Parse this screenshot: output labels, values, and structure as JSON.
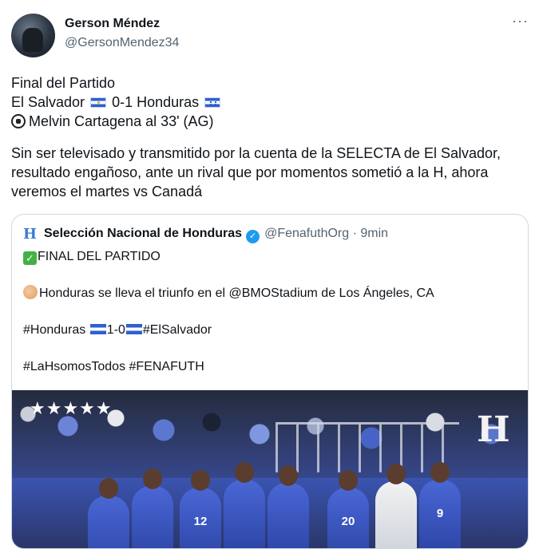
{
  "author": {
    "name": "Gerson Méndez",
    "handle": "@GersonMendez34",
    "more_label": "···"
  },
  "tweet": {
    "line1": "Final del  Partido",
    "score_team1": "El Salvador",
    "score": "0-1",
    "score_team2": "Honduras",
    "scorer": "Melvin Cartagena al 33' (AG)",
    "paragraph": "Sin ser televisado y transmitido por la cuenta de la SELECTA de El Salvador, resultado engañoso, ante un rival que por momentos sometió a la H, ahora veremos el martes vs Canadá"
  },
  "quoted": {
    "logo_letter": "H",
    "name": "Selección Nacional de Honduras",
    "verified_glyph": "✓",
    "handle": "@FenafuthOrg",
    "separator": "·",
    "time": "9min",
    "line1": "FINAL DEL PARTIDO",
    "line2": "Honduras se lleva el triunfo en el @BMOStadium de Los Ángeles, CA",
    "line3_a": "#Honduras",
    "line3_b": "1-0",
    "line3_c": "#ElSalvador",
    "line4": "#LaHsomosTodos #FENAFUTH"
  },
  "photo": {
    "stars": "★★★★★",
    "crest_letter": "H",
    "jersey_numbers": [
      "",
      "",
      "12",
      "",
      "",
      "20",
      "",
      "9"
    ]
  },
  "colors": {
    "text": "#0f1419",
    "muted": "#536471",
    "border": "#cfd9de",
    "verified": "#1d9bf0",
    "honduras_blue": "#2f5fd0"
  },
  "icons": [
    "el-salvador-flag-icon",
    "honduras-flag-icon",
    "soccer-ball-icon",
    "check-icon",
    "clap-icon",
    "verified-icon",
    "more-icon"
  ]
}
